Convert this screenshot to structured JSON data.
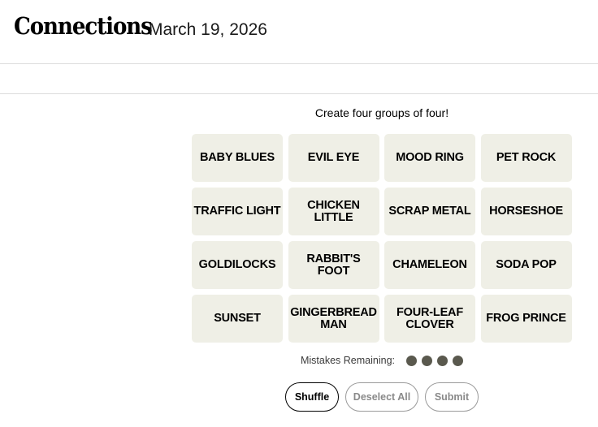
{
  "header": {
    "title": "Connections",
    "date": "March 19, 2026"
  },
  "game": {
    "instructions": "Create four groups of four!",
    "tiles": [
      "BABY BLUES",
      "EVIL EYE",
      "MOOD RING",
      "PET ROCK",
      "TRAFFIC LIGHT",
      "CHICKEN LITTLE",
      "SCRAP METAL",
      "HORSESHOE",
      "GOLDILOCKS",
      "RABBIT'S FOOT",
      "CHAMELEON",
      "SODA POP",
      "SUNSET",
      "GINGERBREAD\nMAN",
      "FOUR-LEAF\nCLOVER",
      "FROG PRINCE"
    ],
    "mistakes_label": "Mistakes Remaining:",
    "mistakes_remaining": 4
  },
  "buttons": {
    "shuffle": "Shuffle",
    "deselect_all": "Deselect All",
    "submit": "Submit"
  },
  "colors": {
    "tile_bg": "#efefe6",
    "dot": "#5a594e"
  }
}
